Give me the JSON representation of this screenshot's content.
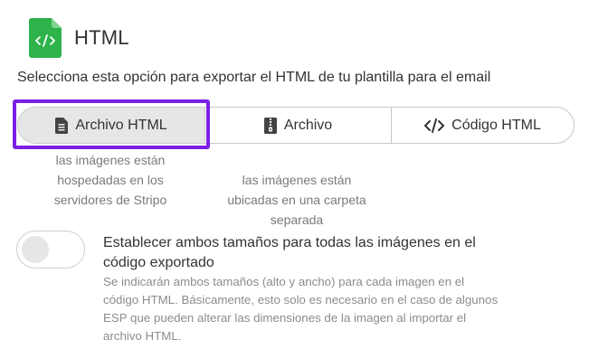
{
  "header": {
    "title": "HTML",
    "icon": "html-file-icon",
    "icon_color": "#2db34a"
  },
  "description": "Selecciona esta opción para exportar el HTML de tu plantilla para el email",
  "export_options": {
    "selected": "Archivo HTML",
    "highlight_color": "#7b1fe6",
    "items": [
      {
        "label": "Archivo HTML",
        "icon": "document-icon"
      },
      {
        "label": "Archivo",
        "icon": "zip-file-icon"
      },
      {
        "label": "Código HTML",
        "icon": "code-icon"
      }
    ],
    "hints": [
      [
        "las imágenes están",
        "hospedadas en los",
        "servidores de Stripo"
      ],
      [
        "las imágenes están",
        "ubicadas en una carpeta",
        "separada"
      ]
    ]
  },
  "toggle": {
    "checked": false,
    "title_lines": [
      "Establecer ambos tamaños para todas las imágenes en el",
      "código exportado"
    ],
    "description_lines": [
      "Se indicarán ambos tamaños (alto y ancho) para cada imagen en el",
      "código HTML. Básicamente, esto solo es necesario en el caso de algunos",
      "ESP que pueden alterar las dimensiones de la imagen al importar el",
      "archivo HTML."
    ]
  }
}
